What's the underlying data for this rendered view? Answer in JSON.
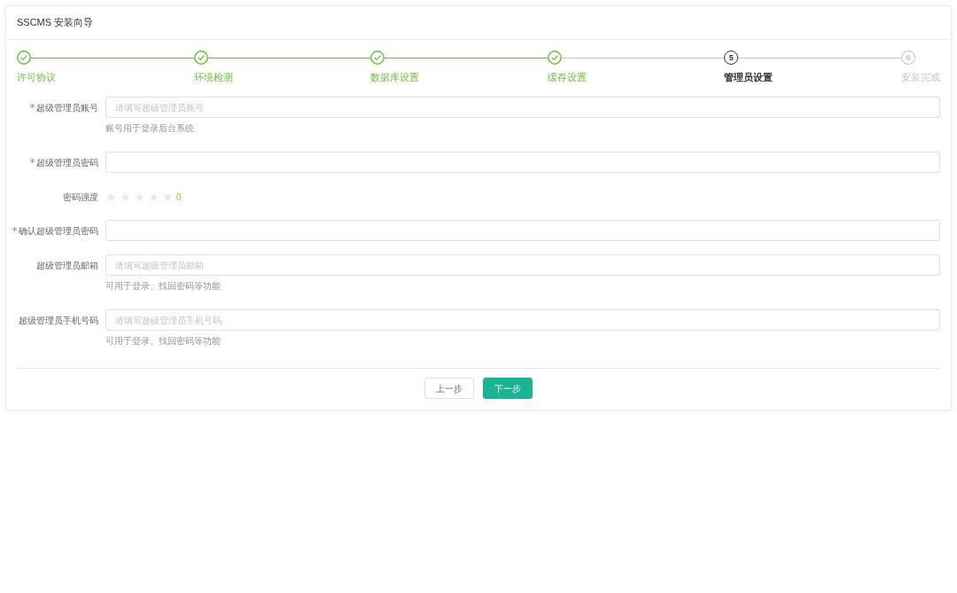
{
  "window": {
    "title": "SSCMS 安装向导"
  },
  "steps": [
    {
      "label": "许可协议",
      "completed": true,
      "selected": false
    },
    {
      "label": "环境检测",
      "completed": true,
      "selected": false
    },
    {
      "label": "数据库设置",
      "completed": true,
      "selected": false
    },
    {
      "label": "缓存设置",
      "completed": true,
      "selected": false
    },
    {
      "label": "管理员设置",
      "completed": false,
      "selected": true,
      "number": "5"
    },
    {
      "label": "安装完成",
      "completed": false,
      "selected": false,
      "number": "6"
    }
  ],
  "form": {
    "fields": [
      {
        "kind": "input",
        "label": "超级管理员账号",
        "required": true,
        "placeholder": "请填写超级管理员账号",
        "hint": "账号用于登录后台系统"
      },
      {
        "kind": "input",
        "label": "超级管理员密码",
        "required": true
      },
      {
        "kind": "rating",
        "label": "密码强度",
        "required": false,
        "stars": 0,
        "reading": "0"
      },
      {
        "kind": "input",
        "label": "确认超级管理员密码",
        "required": true
      },
      {
        "kind": "input",
        "label": "超级管理员邮箱",
        "required": false,
        "placeholder": "请填写超级管理员邮箱",
        "hint": "可用于登录、找回密码等功能"
      },
      {
        "kind": "input",
        "label": "超级管理员手机号码",
        "required": false,
        "placeholder": "请填写超级管理员手机号码",
        "hint": "可用于登录、找回密码等功能"
      }
    ]
  },
  "buttons": [
    {
      "label": "上一步",
      "kind": "secondary"
    },
    {
      "label": "下一步",
      "kind": "primary"
    }
  ]
}
